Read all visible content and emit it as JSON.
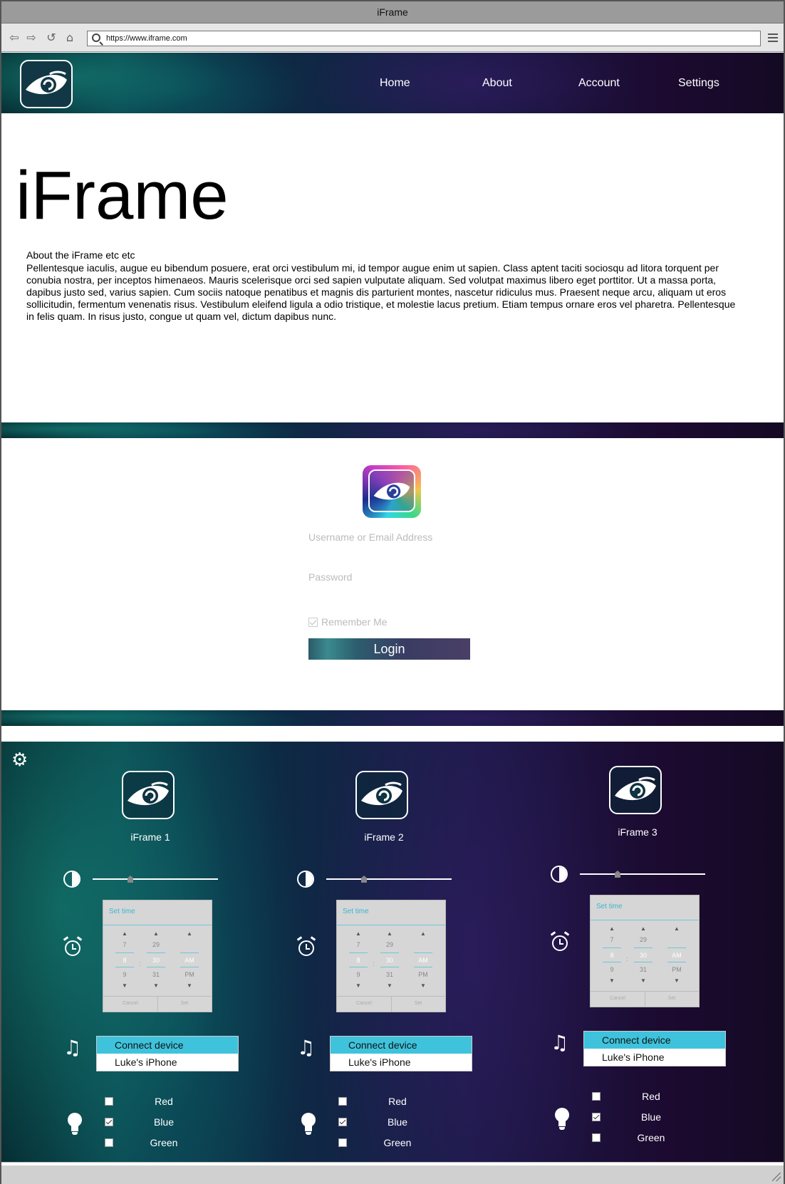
{
  "window": {
    "title": "iFrame"
  },
  "toolbar": {
    "url": "https://www.iframe.com"
  },
  "nav": {
    "links": [
      "Home",
      "About",
      "Account",
      "Settings"
    ]
  },
  "hero": {
    "title": "iFrame",
    "subtitle": "About the iFrame etc etc",
    "body": "Pellentesque iaculis, augue eu bibendum posuere, erat orci vestibulum mi, id tempor augue enim ut sapien. Class aptent taciti sociosqu ad litora torquent per conubia nostra, per inceptos himenaeos. Mauris scelerisque orci sed sapien vulputate aliquam. Sed volutpat maximus libero eget porttitor. Ut a massa porta, dapibus justo sed, varius sapien. Cum sociis natoque penatibus et magnis dis parturient montes, nascetur ridiculus mus. Praesent neque arcu, aliquam ut eros sollicitudin, fermentum venenatis risus. Vestibulum eleifend ligula a odio tristique, et molestie lacus pretium. Etiam tempus ornare eros vel pharetra. Pellentesque in felis quam. In risus justo, congue ut quam vel, dictum dapibus nunc."
  },
  "login": {
    "username_placeholder": "Username or Email Address",
    "password_placeholder": "Password",
    "remember_label": "Remember Me",
    "remember_checked": true,
    "button_label": "Login"
  },
  "devices": [
    {
      "name": "iFrame 1",
      "brightness_fraction": 0.3,
      "time_picker": {
        "title": "Set time",
        "hours": [
          "7",
          "8",
          "9"
        ],
        "minutes": [
          "29",
          "30",
          "31"
        ],
        "ampm": [
          "",
          "AM",
          "PM"
        ],
        "cancel": "Cancel",
        "set": "Set"
      },
      "connect": {
        "header": "Connect device",
        "option": "Luke's iPhone"
      },
      "colors": [
        {
          "label": "Red",
          "checked": false
        },
        {
          "label": "Blue",
          "checked": true
        },
        {
          "label": "Green",
          "checked": false
        }
      ]
    },
    {
      "name": "iFrame 2",
      "brightness_fraction": 0.3,
      "time_picker": {
        "title": "Set time",
        "hours": [
          "7",
          "8",
          "9"
        ],
        "minutes": [
          "29",
          "30",
          "31"
        ],
        "ampm": [
          "",
          "AM",
          "PM"
        ],
        "cancel": "Cancel",
        "set": "Set"
      },
      "connect": {
        "header": "Connect device",
        "option": "Luke's iPhone"
      },
      "colors": [
        {
          "label": "Red",
          "checked": false
        },
        {
          "label": "Blue",
          "checked": true
        },
        {
          "label": "Green",
          "checked": false
        }
      ]
    },
    {
      "name": "iFrame 3",
      "brightness_fraction": 0.3,
      "time_picker": {
        "title": "Set time",
        "hours": [
          "7",
          "8",
          "9"
        ],
        "minutes": [
          "29",
          "30",
          "31"
        ],
        "ampm": [
          "",
          "AM",
          "PM"
        ],
        "cancel": "Cancel",
        "set": "Set"
      },
      "connect": {
        "header": "Connect device",
        "option": "Luke's iPhone"
      },
      "colors": [
        {
          "label": "Red",
          "checked": false
        },
        {
          "label": "Blue",
          "checked": true
        },
        {
          "label": "Green",
          "checked": false
        }
      ]
    }
  ],
  "icons": {
    "back": "back-arrow-icon",
    "forward": "forward-arrow-icon",
    "reload": "reload-icon",
    "home": "home-icon",
    "search": "search-icon",
    "menu": "hamburger-menu-icon",
    "logo": "eye-logo-icon",
    "settings": "gear-icon",
    "brightness": "contrast-icon",
    "alarm": "alarm-clock-icon",
    "music": "music-note-icon",
    "light": "light-bulb-icon"
  },
  "colors": {
    "accent": "#3fc3dc",
    "header_dark": "#140a24",
    "header_teal": "#0b4a52"
  }
}
